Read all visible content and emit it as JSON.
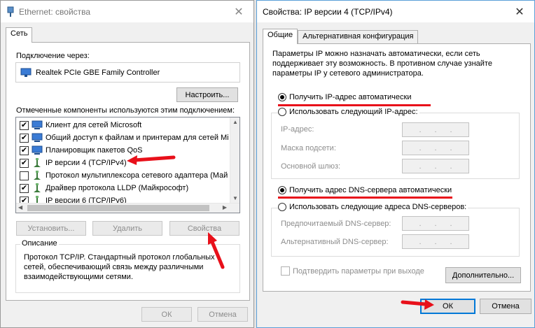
{
  "left_window": {
    "title": "Ethernet: свойства",
    "tab": "Сеть",
    "connect_via_label": "Подключение через:",
    "adapter": "Realtek PCIe GBE Family Controller",
    "configure_button": "Настроить...",
    "components_label": "Отмеченные компоненты используются этим подключением:",
    "components": [
      {
        "label": "Клиент для сетей Microsoft",
        "checked": true,
        "icon": "network-client-icon"
      },
      {
        "label": "Общий доступ к файлам и принтерам для сетей Mi",
        "checked": true,
        "icon": "file-sharing-icon"
      },
      {
        "label": "Планировщик пакетов QoS",
        "checked": true,
        "icon": "qos-icon"
      },
      {
        "label": "IP версии 4 (TCP/IPv4)",
        "checked": true,
        "icon": "protocol-icon"
      },
      {
        "label": "Протокол мультиплексора сетевого адаптера (Май",
        "checked": false,
        "icon": "protocol-icon"
      },
      {
        "label": "Драйвер протокола LLDP (Майкрософт)",
        "checked": true,
        "icon": "protocol-icon"
      },
      {
        "label": "IP версии 6 (TCP/IPv6)",
        "checked": true,
        "icon": "protocol-icon"
      }
    ],
    "install_button": "Установить...",
    "remove_button": "Удалить",
    "properties_button": "Свойства",
    "description_label": "Описание",
    "description_text": "Протокол TCP/IP. Стандартный протокол глобальных сетей, обеспечивающий связь между различными взаимодействующими сетями.",
    "ok_button": "ОК",
    "cancel_button": "Отмена"
  },
  "right_window": {
    "title": "Свойства: IP версии 4 (TCP/IPv4)",
    "tabs": [
      "Общие",
      "Альтернативная конфигурация"
    ],
    "intro_text": "Параметры IP можно назначать автоматически, если сеть поддерживает эту возможность. В противном случае узнайте параметры IP у сетевого администратора.",
    "ip_auto": "Получить IP-адрес автоматически",
    "ip_manual": "Использовать следующий IP-адрес:",
    "ip_address_label": "IP-адрес:",
    "subnet_label": "Маска подсети:",
    "gateway_label": "Основной шлюз:",
    "dns_auto": "Получить адрес DNS-сервера автоматически",
    "dns_manual": "Использовать следующие адреса DNS-серверов:",
    "dns_preferred_label": "Предпочитаемый DNS-сервер:",
    "dns_alternate_label": "Альтернативный DNS-сервер:",
    "validate_label": "Подтвердить параметры при выходе",
    "advanced_button": "Дополнительно...",
    "ok_button": "ОК",
    "cancel_button": "Отмена",
    "ip_auto_selected": true,
    "dns_auto_selected": true
  },
  "colors": {
    "annotation_red": "#e8101a",
    "accent": "#0078d7"
  }
}
